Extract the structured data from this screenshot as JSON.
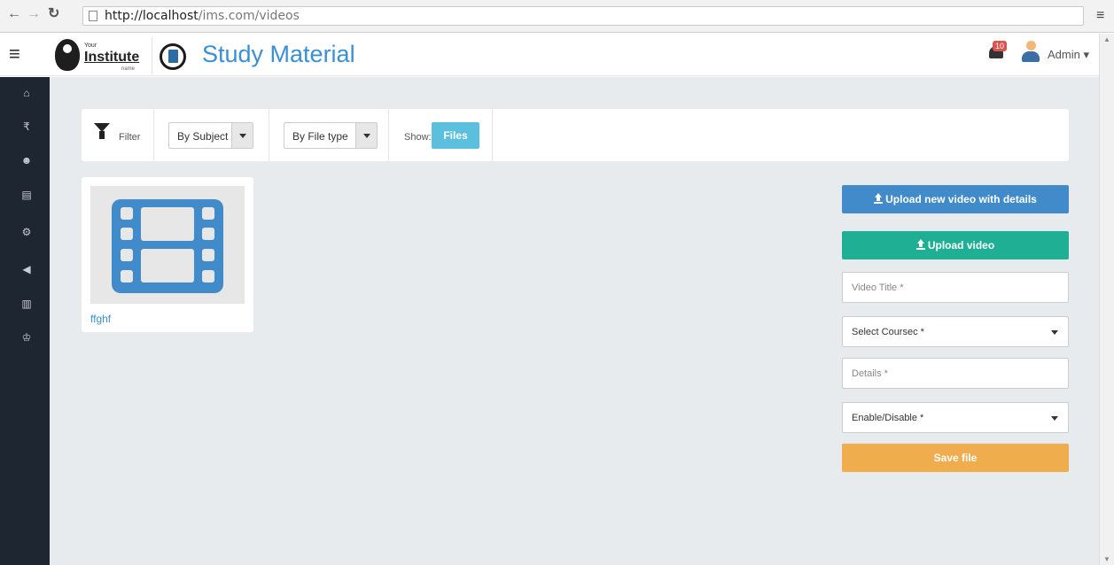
{
  "browser": {
    "url_host": "http://localhost",
    "url_path": "/ims.com/videos"
  },
  "header": {
    "logo_your": "Your",
    "logo_institute": "Institute",
    "logo_name": "name",
    "title": "Study Material",
    "notification_count": "10",
    "user": "Admin"
  },
  "sidebar": {
    "icons": [
      "home-icon",
      "rupee-icon",
      "users-icon",
      "document-icon",
      "gears-icon",
      "megaphone-icon",
      "bar-chart-icon",
      "trophy-icon"
    ]
  },
  "filter": {
    "label": "Filter",
    "subject_select": "By Subject",
    "filetype_select": "By File type",
    "show_label": "Show:",
    "files_button": "Files"
  },
  "videos": [
    {
      "title": "ffghf"
    }
  ],
  "form": {
    "upload_details_button": "Upload new video with details",
    "upload_button": "Upload video",
    "video_title_placeholder": "Video Title *",
    "course_select": "Select Coursec *",
    "details_placeholder": "Details *",
    "enable_select": "Enable/Disable *",
    "save_button": "Save file"
  },
  "colors": {
    "accent": "#3a8fd6",
    "sidebar": "#1d2631",
    "info": "#5bc0de",
    "primary": "#428bca",
    "success": "#1eaf94",
    "warning": "#f0ad4e"
  }
}
